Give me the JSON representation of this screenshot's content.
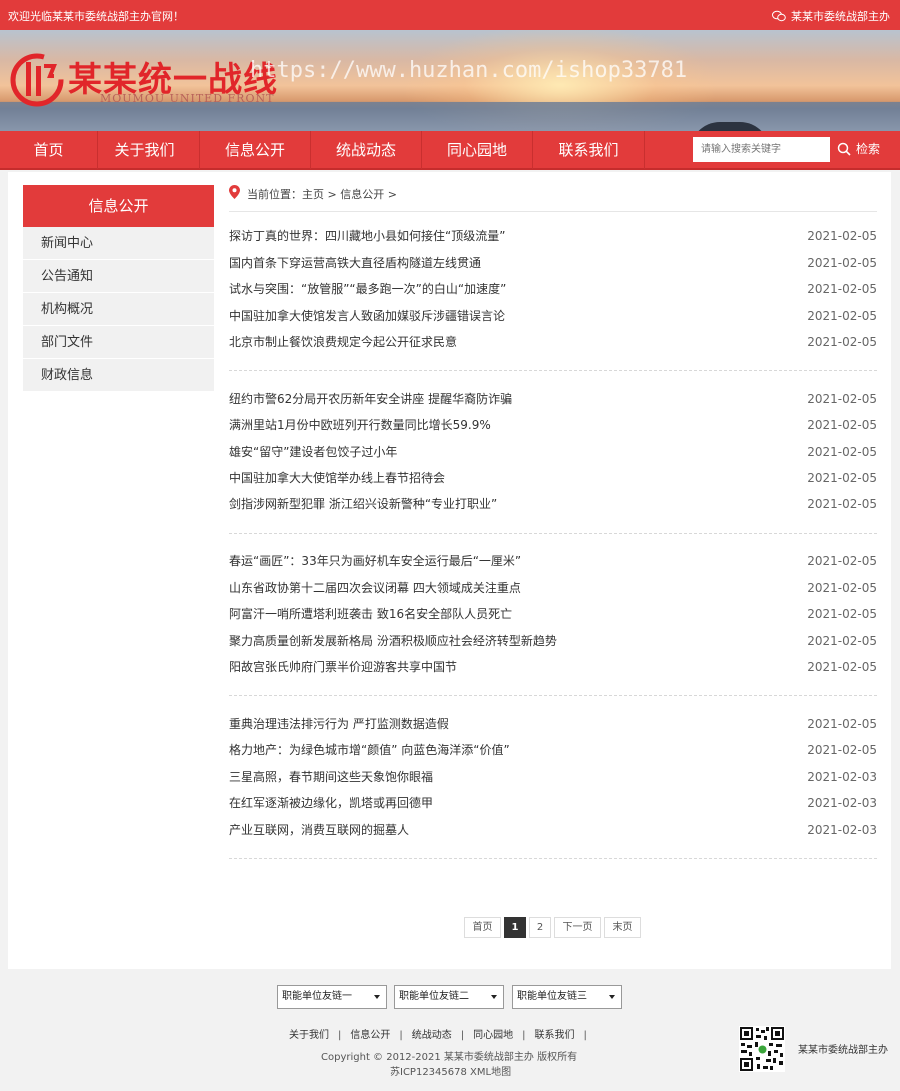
{
  "topbar": {
    "welcome": "欢迎光临某某市委统战部主办官网！",
    "right_label": "某某市委统战部主办",
    "wechat_icon": "wechat-icon"
  },
  "header": {
    "logo_cn": "某某统一战线",
    "logo_en": "MOUMOU UNITED FRONT",
    "watermark": "https://www.huzhan.com/ishop33781",
    "brand_color": "#e23b3b"
  },
  "nav": {
    "items": [
      "首页",
      "关于我们",
      "信息公开",
      "统战动态",
      "同心园地",
      "联系我们"
    ],
    "search_placeholder": "请输入搜索关键字",
    "search_label": "检索"
  },
  "sidebar": {
    "title": "信息公开",
    "items": [
      "新闻中心",
      "公告通知",
      "机构概况",
      "部门文件",
      "财政信息"
    ]
  },
  "breadcrumb": {
    "text": "当前位置：主页 > 信息公开 >"
  },
  "news_groups": [
    [
      {
        "title": "探访丁真的世界：四川藏地小县如何接住“顶级流量”",
        "date": "2021-02-05"
      },
      {
        "title": "国内首条下穿运营高铁大直径盾构隧道左线贯通",
        "date": "2021-02-05"
      },
      {
        "title": "试水与突围：“放管服”“最多跑一次”的白山“加速度”",
        "date": "2021-02-05"
      },
      {
        "title": "中国驻加拿大使馆发言人致函加媒驳斥涉疆错误言论",
        "date": "2021-02-05"
      },
      {
        "title": "北京市制止餐饮浪费规定今起公开征求民意",
        "date": "2021-02-05"
      }
    ],
    [
      {
        "title": "纽约市警62分局开农历新年安全讲座 提醒华裔防诈骗",
        "date": "2021-02-05"
      },
      {
        "title": "满洲里站1月份中欧班列开行数量同比增长59.9%",
        "date": "2021-02-05"
      },
      {
        "title": "雄安“留守”建设者包饺子过小年",
        "date": "2021-02-05"
      },
      {
        "title": "中国驻加拿大大使馆举办线上春节招待会",
        "date": "2021-02-05"
      },
      {
        "title": "剑指涉网新型犯罪 浙江绍兴设新警种“专业打职业”",
        "date": "2021-02-05"
      }
    ],
    [
      {
        "title": "春运“画匠”：33年只为画好机车安全运行最后“一厘米”",
        "date": "2021-02-05"
      },
      {
        "title": "山东省政协第十二届四次会议闭幕 四大领域成关注重点",
        "date": "2021-02-05"
      },
      {
        "title": "阿富汗一哨所遭塔利班袭击 致16名安全部队人员死亡",
        "date": "2021-02-05"
      },
      {
        "title": "聚力高质量创新发展新格局 汾酒积极顺应社会经济转型新趋势",
        "date": "2021-02-05"
      },
      {
        "title": "阳故宫张氏帅府门票半价迎游客共享中国节",
        "date": "2021-02-05"
      }
    ],
    [
      {
        "title": "重典治理违法排污行为 严打监测数据造假",
        "date": "2021-02-05"
      },
      {
        "title": "格力地产：为绿色城市增“颜值” 向蓝色海洋添“价值”",
        "date": "2021-02-05"
      },
      {
        "title": "三星高照，春节期间这些天象饱你眼福",
        "date": "2021-02-03"
      },
      {
        "title": "在红军逐渐被边缘化，凯塔或再回德甲",
        "date": "2021-02-03"
      },
      {
        "title": "产业互联网，消费互联网的掘墓人",
        "date": "2021-02-03"
      }
    ]
  ],
  "pagination": {
    "first": "首页",
    "pages": [
      "1",
      "2"
    ],
    "current": "1",
    "next": "下一页",
    "last": "末页"
  },
  "footer": {
    "selects": [
      "职能单位友链一",
      "职能单位友链二",
      "职能单位友链三"
    ],
    "links": [
      "关于我们",
      "信息公开",
      "统战动态",
      "同心园地",
      "联系我们"
    ],
    "copyright": "Copyright © 2012-2021 某某市委统战部主办 版权所有",
    "icp": "苏ICP12345678 XML地图",
    "qr_label": "某某市委统战部主办",
    "qr_icon": "qr-code-icon"
  }
}
